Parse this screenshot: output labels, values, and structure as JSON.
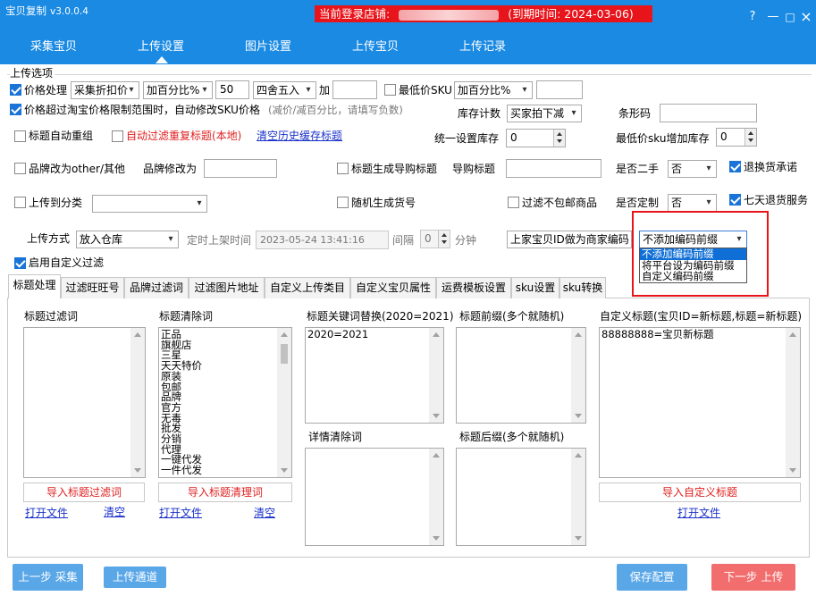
{
  "titlebar": {
    "app_title": "宝贝复制",
    "version": "v3.0.0.4",
    "store_prefix": "当前登录店铺:",
    "expiry": "(到期时间: 2024-03-06)",
    "help": "?",
    "minimize": "—",
    "maximize": "□",
    "close": "×"
  },
  "nav": {
    "tabs": [
      "采集宝贝",
      "上传设置",
      "图片设置",
      "上传宝贝",
      "上传记录"
    ],
    "active": "上传设置"
  },
  "upload_options": {
    "group_title": "上传选项",
    "price_handle_label": "价格处理",
    "price_handle_mode": "采集折扣价",
    "price_add_mode": "加百分比%",
    "price_value": "50",
    "rounding": "四舍五入",
    "plus_label": "加",
    "plus_value": "",
    "lowest_price_sku_label": "最低价SKU",
    "lowest_price_add_mode": "加百分比%",
    "lowest_price_value": "",
    "limit_price_label": "价格超过淘宝价格限制范围时，自动修改SKU价格",
    "limit_price_hint": "(减价/减百分比，请填写负数)",
    "inventory_count_label": "库存计数",
    "inventory_count_value": "买家拍下减",
    "barcode_label": "条形码",
    "barcode_value": "",
    "auto_regroup_label": "标题自动重组",
    "auto_filter_dup_label": "自动过滤重复标题(本地)",
    "clear_history_link": "清空历史缓存标题",
    "unified_stock_label": "统一设置库存",
    "unified_stock_value": "0",
    "lowest_sku_stock_label": "最低价sku增加库存",
    "lowest_sku_stock_value": "0",
    "brand_other_label": "品牌改为other/其他",
    "brand_modify_label": "品牌修改为",
    "brand_modify_value": "",
    "gen_shopping_title_label": "标题生成导购标题",
    "shopping_title_label": "导购标题",
    "shopping_title_value": "",
    "second_hand_label": "是否二手",
    "second_hand_value": "否",
    "return_promise_label": "退换货承诺",
    "upload_category_label": "上传到分类",
    "upload_category_value": "",
    "random_item_no_label": "随机生成货号",
    "filter_no_free_shipping_label": "过滤不包邮商品",
    "custom_made_label": "是否定制",
    "custom_made_value": "否",
    "seven_day_return_label": "七天退货服务",
    "upload_mode_label": "上传方式",
    "upload_mode_value": "放入仓库",
    "scheduled_label": "定时上架时间",
    "scheduled_value": "2023-05-24 13:41:16",
    "interval_label": "间隔",
    "interval_value": "0",
    "minute_label": "分钟",
    "merchant_code_value": "上家宝贝ID做为商家编码",
    "prefix_select_value": "不添加编码前缀",
    "prefix_options": [
      "不添加编码前缀",
      "将平台设为编码前缀",
      "自定义编码前缀"
    ],
    "enable_custom_filter_label": "启用自定义过滤"
  },
  "subtabs": [
    "标题处理",
    "过滤旺旺号",
    "品牌过滤词",
    "过滤图片地址",
    "自定义上传类目",
    "自定义宝贝属性",
    "运费模板设置",
    "sku设置",
    "sku转换"
  ],
  "title_panel": {
    "filter_words_title": "标题过滤词",
    "filter_words_content": "",
    "clear_words_title": "标题清除词",
    "clear_words_content": "正品\n旗舰店\n三星\n天天特价\n原装\n包邮\n品牌\n官方\n无毒\n批发\n分销\n代理\n一键代发\n一件代发",
    "keyword_replace_title": "标题关键词替换(2020=2021)",
    "keyword_replace_content": "2020=2021",
    "prefix_title": "标题前缀(多个就随机)",
    "prefix_content": "",
    "custom_title_title": "自定义标题(宝贝ID=新标题,标题=新标题)",
    "custom_title_content": "88888888=宝贝新标题",
    "detail_clear_title": "详情清除词",
    "detail_clear_content": "",
    "suffix_title": "标题后缀(多个就随机)",
    "suffix_content": "",
    "import_filter_btn": "导入标题过滤词",
    "import_clear_btn": "导入标题清理词",
    "import_custom_btn": "导入自定义标题",
    "open_file": "打开文件",
    "clear": "清空"
  },
  "footer": {
    "prev_btn": "上一步 采集",
    "channel_btn": "上传通道",
    "save_btn": "保存配置",
    "next_btn": "下一步 上传"
  },
  "colors": {
    "header_blue": "#1a8ae3",
    "store_red": "#e8141b",
    "footer_blue": "#5aa7e8",
    "footer_red": "#f26d6d"
  }
}
